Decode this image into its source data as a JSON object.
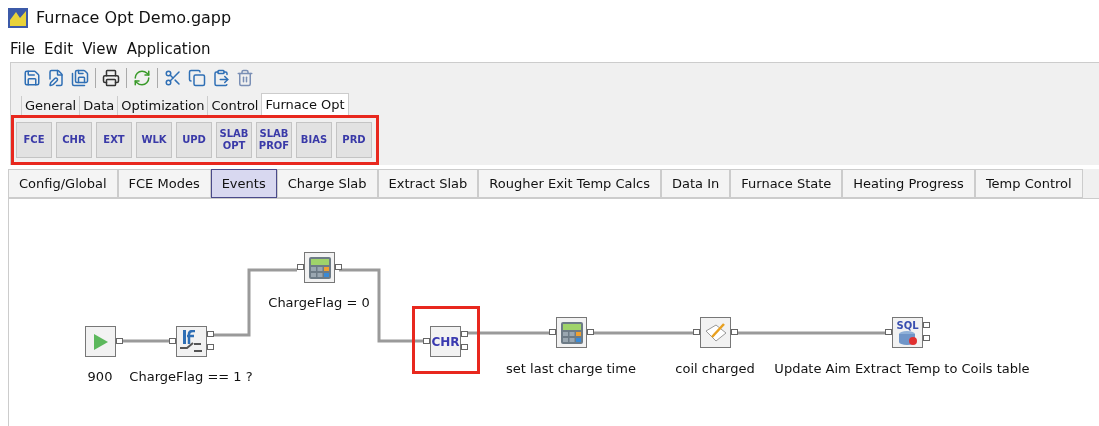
{
  "window": {
    "title": "Furnace Opt Demo.gapp"
  },
  "menu": [
    "File",
    "Edit",
    "View",
    "Application"
  ],
  "toolbar": [
    {
      "kind": "save"
    },
    {
      "kind": "save_as"
    },
    {
      "kind": "save_all"
    },
    {
      "kind": "sep"
    },
    {
      "kind": "print"
    },
    {
      "kind": "sep"
    },
    {
      "kind": "refresh"
    },
    {
      "kind": "sep"
    },
    {
      "kind": "cut"
    },
    {
      "kind": "copy"
    },
    {
      "kind": "paste"
    },
    {
      "kind": "delete"
    }
  ],
  "ribbon_tabs": [
    {
      "label": "General",
      "selected": false
    },
    {
      "label": "Data",
      "selected": false
    },
    {
      "label": "Optimization",
      "selected": false
    },
    {
      "label": "Control",
      "selected": false
    },
    {
      "label": "Furnace Opt",
      "selected": true
    }
  ],
  "ribbon_buttons": [
    {
      "lines": [
        "FCE"
      ]
    },
    {
      "lines": [
        "CHR"
      ]
    },
    {
      "lines": [
        "EXT"
      ]
    },
    {
      "lines": [
        "WLK"
      ]
    },
    {
      "lines": [
        "UPD"
      ]
    },
    {
      "lines": [
        "SLAB",
        "OPT"
      ]
    },
    {
      "lines": [
        "SLAB",
        "PROF"
      ]
    },
    {
      "lines": [
        "BIAS"
      ]
    },
    {
      "lines": [
        "PRD"
      ]
    }
  ],
  "tabs": [
    {
      "label": "Config/Global",
      "selected": false
    },
    {
      "label": "FCE Modes",
      "selected": false
    },
    {
      "label": "Events",
      "selected": true
    },
    {
      "label": "Charge Slab",
      "selected": false
    },
    {
      "label": "Extract Slab",
      "selected": false
    },
    {
      "label": "Rougher Exit Temp Calcs",
      "selected": false
    },
    {
      "label": "Data In",
      "selected": false
    },
    {
      "label": "Furnace State",
      "selected": false
    },
    {
      "label": "Heating Progress",
      "selected": false
    },
    {
      "label": "Temp Control",
      "selected": false
    }
  ],
  "diagram": {
    "nodes": [
      {
        "kind": "start",
        "label": "900",
        "highlighted": false
      },
      {
        "kind": "if",
        "label": "ChargeFlag == 1 ?",
        "highlighted": false
      },
      {
        "kind": "calc",
        "label": "ChargeFlag = 0",
        "highlighted": false
      },
      {
        "kind": "text",
        "text": "CHR",
        "highlighted": true
      },
      {
        "kind": "calc",
        "label": "set last charge time",
        "highlighted": false
      },
      {
        "kind": "note",
        "label": "coil charged",
        "highlighted": false
      },
      {
        "kind": "sql",
        "text": "SQL",
        "label": "Update Aim Extract Temp to Coils table",
        "highlighted": false
      }
    ]
  }
}
